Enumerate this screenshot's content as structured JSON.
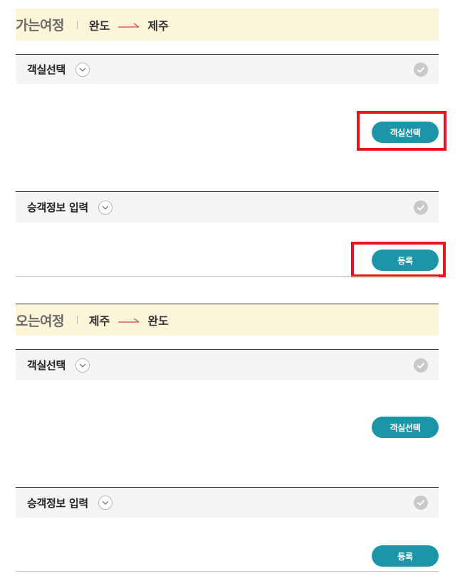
{
  "outbound": {
    "title": "가는여정",
    "from": "완도",
    "to": "제주",
    "cabin_section": {
      "title": "객실선택",
      "button_label": "객실선택"
    },
    "passenger_section": {
      "title": "승객정보 입력",
      "button_label": "등록"
    }
  },
  "inbound": {
    "title": "오는여정",
    "from": "제주",
    "to": "완도",
    "cabin_section": {
      "title": "객실선택",
      "button_label": "객실선택"
    },
    "passenger_section": {
      "title": "승객정보 입력",
      "button_label": "등록"
    }
  },
  "icons": {
    "route_arrow": "right-arrow-icon",
    "toggle": "chevron-down-icon",
    "status": "check-circle-icon"
  },
  "colors": {
    "header_bg": "#fdf5d8",
    "button_bg": "#1b96a9",
    "route_arrow": "#d9424a",
    "highlight": "#e8141b",
    "check": "#c9c9c9"
  }
}
